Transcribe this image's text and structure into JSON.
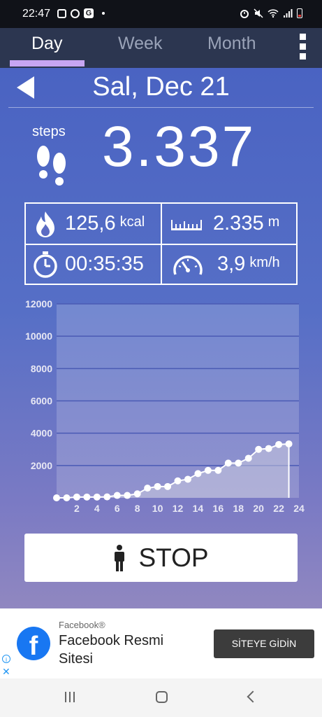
{
  "status_bar": {
    "time": "22:47"
  },
  "tabs": [
    {
      "label": "Day",
      "active": true
    },
    {
      "label": "Week",
      "active": false
    },
    {
      "label": "Month",
      "active": false
    }
  ],
  "header": {
    "date": "Sal, Dec 21"
  },
  "steps": {
    "label": "steps",
    "count": "3.337"
  },
  "stats": {
    "calories": {
      "value": "125,6",
      "unit": "kcal"
    },
    "distance": {
      "value": "2.335",
      "unit": "m"
    },
    "duration": {
      "value": "00:35:35"
    },
    "speed": {
      "value": "3,9",
      "unit": "km/h"
    }
  },
  "chart_data": {
    "type": "line",
    "title": "",
    "xlabel": "",
    "ylabel": "",
    "xlim": [
      0,
      24
    ],
    "ylim": [
      0,
      12000
    ],
    "yticks": [
      2000,
      4000,
      6000,
      8000,
      10000,
      12000
    ],
    "xticks": [
      2,
      4,
      6,
      8,
      10,
      12,
      14,
      16,
      18,
      20,
      22,
      24
    ],
    "grid": true,
    "x": [
      0,
      1,
      2,
      3,
      4,
      5,
      6,
      7,
      8,
      9,
      10,
      11,
      12,
      13,
      14,
      15,
      16,
      17,
      18,
      19,
      20,
      21,
      22,
      23
    ],
    "y": [
      0,
      0,
      50,
      50,
      50,
      60,
      150,
      150,
      250,
      600,
      700,
      700,
      1050,
      1150,
      1500,
      1700,
      1700,
      2150,
      2150,
      2450,
      3000,
      3050,
      3300,
      3337
    ],
    "colors": {
      "fill": "#c9c9de",
      "line": "#ffffff",
      "grid": "#4a5ab4"
    }
  },
  "stop_button": {
    "label": "STOP"
  },
  "ad": {
    "advertiser": "Facebook®",
    "title": "Facebook Resmi Sitesi",
    "cta": "SİTEYE GİDİN"
  },
  "colors": {
    "tab_bar": "#2c3650",
    "tab_indicator": "#c7a6f3",
    "background_top": "#4a63c2",
    "background_bottom": "#9087c0"
  }
}
